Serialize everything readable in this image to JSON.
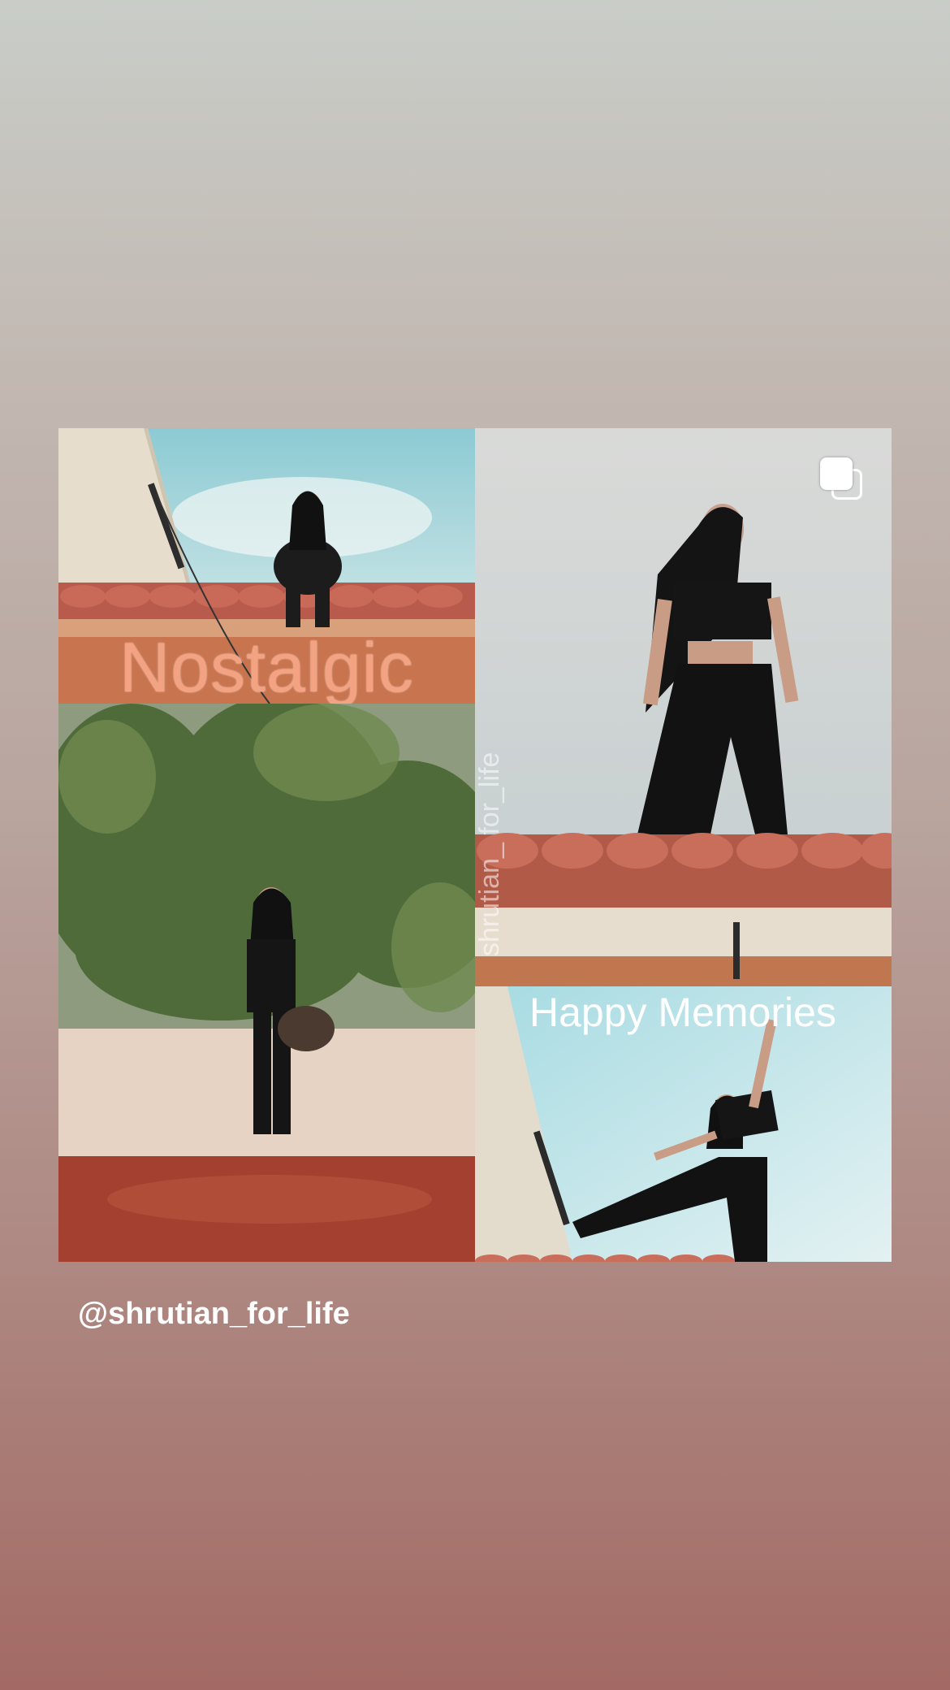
{
  "post": {
    "overlay_text_top_left": "Nostalgic",
    "overlay_text_bottom_right": "Happy Memories",
    "watermark": "shrutian_ for_life",
    "multi_photo_icon": "multiple-images-icon"
  },
  "mention": {
    "label": "@shrutian_for_life"
  },
  "colors": {
    "background_top": "#c9cdc8",
    "background_bottom": "#a36a64",
    "nostalgic_text": "#f4a382",
    "roof_tile": "#b85a4c"
  }
}
